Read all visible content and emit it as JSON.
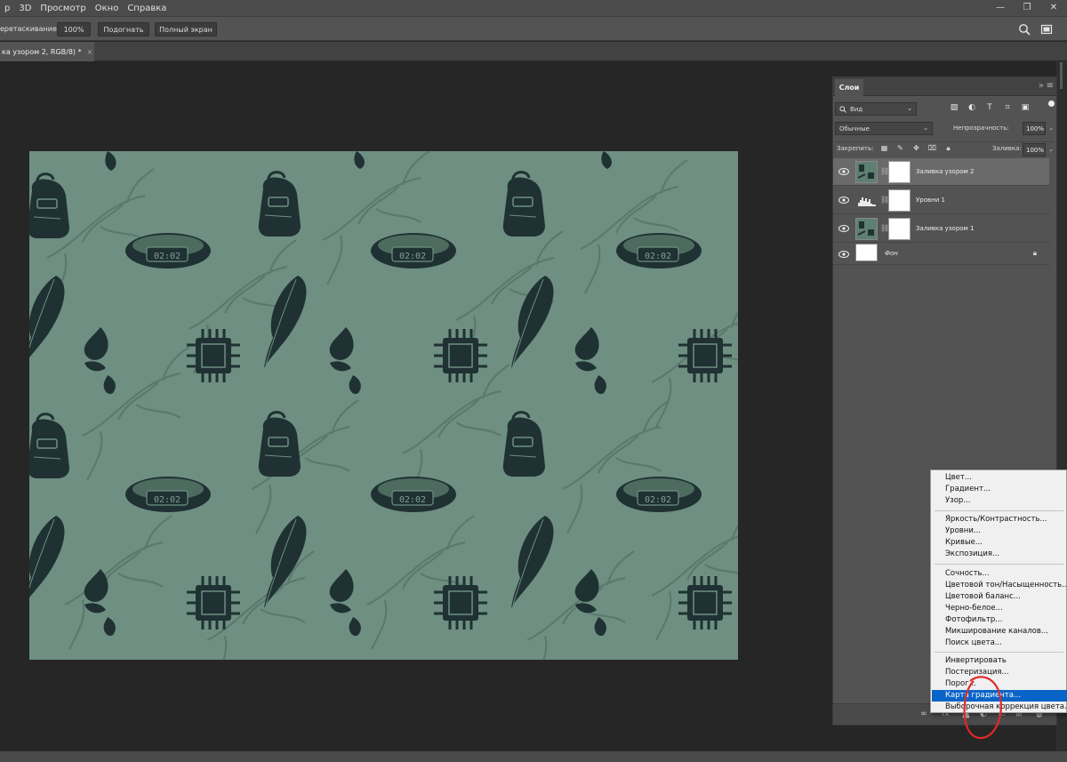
{
  "menubar": {
    "items": [
      "р",
      "3D",
      "Просмотр",
      "Окно",
      "Справка"
    ]
  },
  "window_controls": [
    "—",
    "❐",
    "✕"
  ],
  "options": {
    "scroll_label": "еретаскиванием",
    "zoom_value": "100%",
    "fit_label": "Подогнать",
    "fullscreen_label": "Полный экран",
    "search_icon": "search-icon",
    "frame_icon": "frame-icon"
  },
  "document_tab": {
    "title": "ка узором 2, RGB/8) *",
    "close": "×"
  },
  "canvas": {
    "background_color": "#6e8f81",
    "motif_color": "#1f3133",
    "clock_text": "02:02"
  },
  "layers_panel": {
    "tab_label": "Слои",
    "collapse": "»",
    "menu": "≡",
    "kind_filter": {
      "label": "Вид",
      "icon": "search-icon"
    },
    "filter_icons": [
      "image-filter-icon",
      "adjustment-filter-icon",
      "type-filter-icon",
      "shape-filter-icon",
      "smart-object-filter-icon"
    ],
    "blend_mode": "Обычные",
    "opacity_label": "Непрозрачность:",
    "opacity_value": "100%",
    "lock_label": "Закрепить:",
    "fill_label": "Заливка:",
    "fill_value": "100%",
    "layers": [
      {
        "name": "Заливка узором 2",
        "type": "pattern",
        "selected": true
      },
      {
        "name": "Уровни 1",
        "type": "levels",
        "selected": false
      },
      {
        "name": "Заливка узором 1",
        "type": "pattern",
        "selected": false
      },
      {
        "name": "Фон",
        "type": "background",
        "selected": false,
        "locked": true
      }
    ],
    "footer_icons": [
      "link-layers-icon",
      "fx-icon",
      "add-mask-icon",
      "new-adjustment-icon",
      "new-group-icon",
      "new-layer-icon",
      "delete-layer-icon"
    ]
  },
  "adjustment_menu": {
    "groups": [
      [
        "Цвет...",
        "Градиент...",
        "Узор..."
      ],
      [
        "Яркость/Контрастность...",
        "Уровни...",
        "Кривые...",
        "Экспозиция..."
      ],
      [
        "Сочность...",
        "Цветовой тон/Насыщенность...",
        "Цветовой баланс...",
        "Черно-белое...",
        "Фотофильтр...",
        "Микширование каналов...",
        "Поиск цвета..."
      ],
      [
        "Инвертировать",
        "Постеризация...",
        "Порог...",
        "Карта градиента...",
        "Выборочная коррекция цвета..."
      ]
    ],
    "highlighted": "Карта градиента..."
  }
}
